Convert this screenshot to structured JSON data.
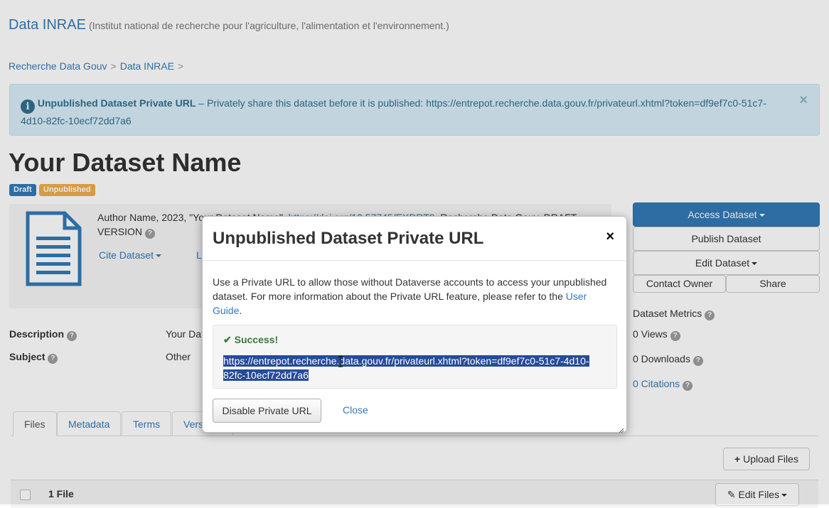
{
  "header": {
    "brand": "Data INRAE",
    "brand_sub": "(Institut national de recherche pour l'agriculture, l'alimentation et l'environnement.)"
  },
  "breadcrumb": {
    "items": [
      "Recherche Data Gouv",
      "Data INRAE"
    ],
    "sep": ">"
  },
  "alert": {
    "title": "Unpublished Dataset Private URL",
    "text": " – Privately share this dataset before it is published: https://entrepot.recherche.data.gouv.fr/privateurl.xhtml?token=df9ef7c0-51c7-4d10-82fc-10ecf72dd7a6",
    "close": "×"
  },
  "dataset": {
    "title": "Your Dataset Name",
    "label_draft": "Draft",
    "label_unpublished": "Unpublished",
    "citation_prefix": "Author Name, 2023, \"Your Dataset Name\", ",
    "citation_doi": "https://doi.org/10.57745/EXDRT9",
    "citation_suffix": ", Recherche Data Gouv, DRAFT VERSION",
    "cite_button": "Cite Dataset",
    "license_partial": "L"
  },
  "metadata": {
    "description_label": "Description",
    "description_value": "Your Dat",
    "subject_label": "Subject",
    "subject_value": "Other"
  },
  "actions": {
    "access": "Access Dataset",
    "publish": "Publish Dataset",
    "edit": "Edit Dataset",
    "contact": "Contact Owner",
    "share": "Share"
  },
  "metrics": {
    "title": "Dataset Metrics",
    "views": "0 Views",
    "downloads": "0 Downloads",
    "citations": "0 Citations"
  },
  "tabs": [
    "Files",
    "Metadata",
    "Terms",
    "Versions"
  ],
  "files": {
    "upload": "Upload Files",
    "count": "1 File",
    "edit": "Edit Files"
  },
  "modal": {
    "title": "Unpublished Dataset Private URL",
    "close": "×",
    "body_text": "Use a Private URL to allow those without Dataverse accounts to access your unpublished dataset. For more information about the Private URL feature, please refer to the ",
    "body_link": "User Guide",
    "body_end": ".",
    "success": "Success!",
    "url": "https://entrepot.recherche.data.gouv.fr/privateurl.xhtml?token=df9ef7c0-51c7-4d10-82fc-10ecf72dd7a6",
    "disable_button": "Disable Private URL",
    "close_link": "Close"
  },
  "colors": {
    "link": "#337ab7",
    "primary": "#337ab7",
    "alert_bg": "#d9edf7",
    "success": "#3c763d",
    "selection": "#264b99"
  },
  "icons": [
    "info-icon",
    "close-icon",
    "document-icon",
    "help-icon",
    "caret-down-icon",
    "plus-icon",
    "pencil-icon",
    "checkmark-icon",
    "text-cursor-icon",
    "resize-handle-icon"
  ]
}
